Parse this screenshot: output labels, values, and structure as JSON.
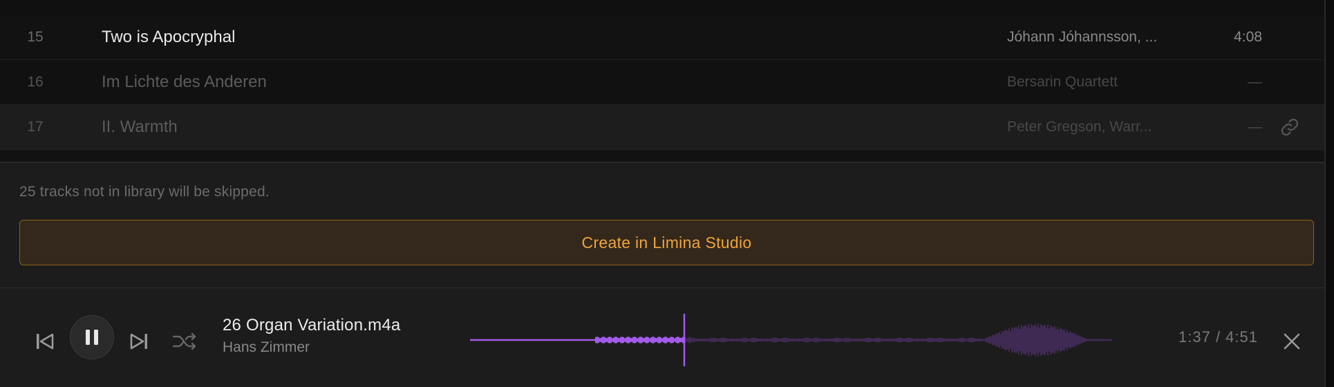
{
  "tracks": [
    {
      "number": "15",
      "title": "Two is Apocryphal",
      "artist": "Jóhann Jóhannsson, ...",
      "duration": "4:08",
      "in_library": true
    },
    {
      "number": "16",
      "title": "Im Lichte des Anderen",
      "artist": "Bersarin Quartett",
      "duration": "—",
      "in_library": false
    },
    {
      "number": "17",
      "title": "II. Warmth",
      "artist": "Peter Gregson, Warr...",
      "duration": "—",
      "in_library": false,
      "icon": "link-icon"
    }
  ],
  "footer": {
    "skip_note": "25 tracks not in library will be skipped.",
    "create_button_label": "Create in Limina Studio"
  },
  "player": {
    "now_playing_title": "26 Organ Variation.m4a",
    "now_playing_artist": "Hans Zimmer",
    "elapsed": "1:37",
    "total": "4:51",
    "time_display": "1:37 / 4:51",
    "progress": 0.333,
    "is_playing": true,
    "controls": [
      "previous-icon",
      "pause-icon",
      "next-icon",
      "shuffle-icon",
      "close-icon"
    ]
  },
  "colors": {
    "accent": "#f0a43a",
    "accent_border": "#8a6419",
    "waveform_played": "#a35be8",
    "waveform_unplayed": "#3e2a52",
    "background": "#1c1c1c"
  }
}
